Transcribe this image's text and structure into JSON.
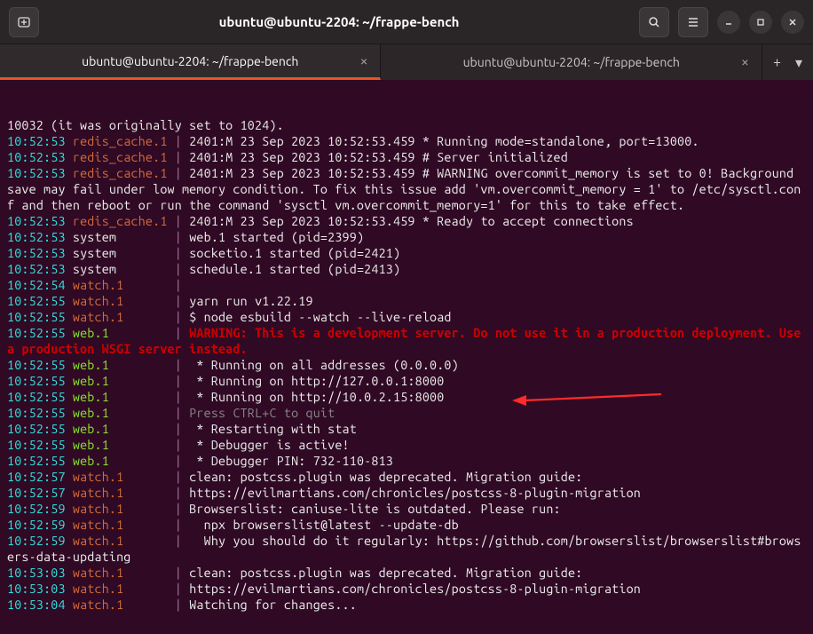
{
  "titlebar": {
    "title": "ubuntu@ubuntu-2204: ~/frappe-bench"
  },
  "tabs": [
    {
      "label": "ubuntu@ubuntu-2204: ~/frappe-bench"
    },
    {
      "label": "ubuntu@ubuntu-2204: ~/frappe-bench"
    }
  ],
  "lines": [
    {
      "ts": "",
      "proc": "",
      "pclass": "",
      "txt": "10032 (it was originally set to 1024).",
      "txtclass": "c-white"
    },
    {
      "ts": "10:52:53",
      "proc": "redis_cache.1",
      "pclass": "c-orange",
      "txt": "2401:M 23 Sep 2023 10:52:53.459 * Running mode=standalone, port=13000.",
      "txtclass": "c-white"
    },
    {
      "ts": "10:52:53",
      "proc": "redis_cache.1",
      "pclass": "c-orange",
      "txt": "2401:M 23 Sep 2023 10:52:53.459 # Server initialized",
      "txtclass": "c-white"
    },
    {
      "ts": "10:52:53",
      "proc": "redis_cache.1",
      "pclass": "c-orange",
      "txt": "2401:M 23 Sep 2023 10:52:53.459 # WARNING overcommit_memory is set to 0! Background save may fail under low memory condition. To fix this issue add 'vm.overcommit_memory = 1' to /etc/sysctl.conf and then reboot or run the command 'sysctl vm.overcommit_memory=1' for this to take effect.",
      "txtclass": "c-white",
      "wrap": true
    },
    {
      "ts": "10:52:53",
      "proc": "redis_cache.1",
      "pclass": "c-orange",
      "txt": "2401:M 23 Sep 2023 10:52:53.459 * Ready to accept connections",
      "txtclass": "c-white"
    },
    {
      "ts": "10:52:53",
      "proc": "system       ",
      "pclass": "c-white",
      "txt": "web.1 started (pid=2399)",
      "txtclass": "c-white"
    },
    {
      "ts": "10:52:53",
      "proc": "system       ",
      "pclass": "c-white",
      "txt": "socketio.1 started (pid=2421)",
      "txtclass": "c-white"
    },
    {
      "ts": "10:52:53",
      "proc": "system       ",
      "pclass": "c-white",
      "txt": "schedule.1 started (pid=2413)",
      "txtclass": "c-white"
    },
    {
      "ts": "10:52:54",
      "proc": "watch.1      ",
      "pclass": "c-orange",
      "txt": "",
      "txtclass": "c-white"
    },
    {
      "ts": "10:52:55",
      "proc": "watch.1      ",
      "pclass": "c-orange",
      "txt": "yarn run v1.22.19",
      "txtclass": "c-white"
    },
    {
      "ts": "10:52:55",
      "proc": "watch.1      ",
      "pclass": "c-orange",
      "txt": "$ node esbuild --watch --live-reload",
      "txtclass": "c-white"
    },
    {
      "ts": "10:52:55",
      "proc": "web.1        ",
      "pclass": "c-green",
      "txt": "WARNING: This is a development server. Do not use it in a production deployment. Use a production WSGI server instead.",
      "txtclass": "c-red",
      "wrap": true
    },
    {
      "ts": "10:52:55",
      "proc": "web.1        ",
      "pclass": "c-green",
      "txt": " * Running on all addresses (0.0.0.0)",
      "txtclass": "c-white"
    },
    {
      "ts": "10:52:55",
      "proc": "web.1        ",
      "pclass": "c-green",
      "txt": " * Running on http://127.0.0.1:8000",
      "txtclass": "c-white"
    },
    {
      "ts": "10:52:55",
      "proc": "web.1        ",
      "pclass": "c-green",
      "txt": " * Running on http://10.0.2.15:8000",
      "txtclass": "c-white"
    },
    {
      "ts": "10:52:55",
      "proc": "web.1        ",
      "pclass": "c-green",
      "txt": "Press CTRL+C to quit",
      "txtclass": "c-grey"
    },
    {
      "ts": "10:52:55",
      "proc": "web.1        ",
      "pclass": "c-green",
      "txt": " * Restarting with stat",
      "txtclass": "c-white"
    },
    {
      "ts": "10:52:55",
      "proc": "web.1        ",
      "pclass": "c-green",
      "txt": " * Debugger is active!",
      "txtclass": "c-white"
    },
    {
      "ts": "10:52:55",
      "proc": "web.1        ",
      "pclass": "c-green",
      "txt": " * Debugger PIN: 732-110-813",
      "txtclass": "c-white"
    },
    {
      "ts": "10:52:57",
      "proc": "watch.1      ",
      "pclass": "c-orange",
      "txt": "clean: postcss.plugin was deprecated. Migration guide:",
      "txtclass": "c-white"
    },
    {
      "ts": "10:52:57",
      "proc": "watch.1      ",
      "pclass": "c-orange",
      "txt": "https://evilmartians.com/chronicles/postcss-8-plugin-migration",
      "txtclass": "c-white"
    },
    {
      "ts": "10:52:59",
      "proc": "watch.1      ",
      "pclass": "c-orange",
      "txt": "Browserslist: caniuse-lite is outdated. Please run:",
      "txtclass": "c-white"
    },
    {
      "ts": "10:52:59",
      "proc": "watch.1      ",
      "pclass": "c-orange",
      "txt": "  npx browserslist@latest --update-db",
      "txtclass": "c-white"
    },
    {
      "ts": "10:52:59",
      "proc": "watch.1      ",
      "pclass": "c-orange",
      "txt": "  Why you should do it regularly: https://github.com/browserslist/browserslist#browsers-data-updating",
      "txtclass": "c-white",
      "wrap": true
    },
    {
      "ts": "10:53:03",
      "proc": "watch.1      ",
      "pclass": "c-orange",
      "txt": "clean: postcss.plugin was deprecated. Migration guide:",
      "txtclass": "c-white"
    },
    {
      "ts": "10:53:03",
      "proc": "watch.1      ",
      "pclass": "c-orange",
      "txt": "https://evilmartians.com/chronicles/postcss-8-plugin-migration",
      "txtclass": "c-white"
    },
    {
      "ts": "10:53:04",
      "proc": "watch.1      ",
      "pclass": "c-orange",
      "txt": "Watching for changes...",
      "txtclass": "c-white"
    }
  ]
}
